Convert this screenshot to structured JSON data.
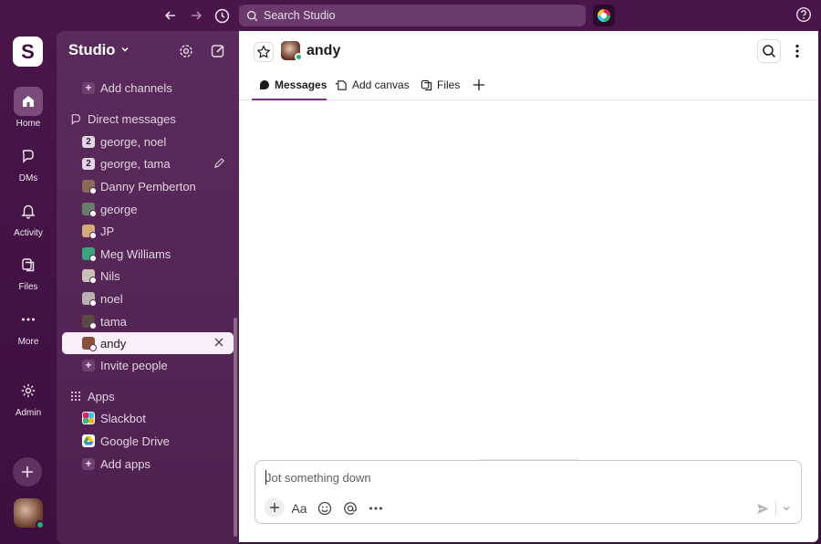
{
  "topbar": {
    "search_placeholder": "Search Studio"
  },
  "rail": {
    "logo_letter": "S",
    "items": [
      {
        "label": "Home",
        "icon": "home-icon"
      },
      {
        "label": "DMs",
        "icon": "dms-icon"
      },
      {
        "label": "Activity",
        "icon": "bell-icon"
      },
      {
        "label": "Files",
        "icon": "files-icon"
      },
      {
        "label": "More",
        "icon": "more-icon"
      },
      {
        "label": "Admin",
        "icon": "gear-icon"
      }
    ]
  },
  "sidebar": {
    "workspace": "Studio",
    "add_channels": "Add channels",
    "dm_section": "Direct messages",
    "dms": [
      {
        "label": "george, noel",
        "badge": "2"
      },
      {
        "label": "george, tama",
        "badge": "2"
      },
      {
        "label": "Danny Pemberton"
      },
      {
        "label": "george"
      },
      {
        "label": "JP"
      },
      {
        "label": "Meg Williams"
      },
      {
        "label": "Nils"
      },
      {
        "label": "noel"
      },
      {
        "label": "tama"
      },
      {
        "label": "andy",
        "active": true
      }
    ],
    "invite_people": "Invite people",
    "apps_section": "Apps",
    "apps": [
      {
        "label": "Slackbot"
      },
      {
        "label": "Google Drive"
      }
    ],
    "add_apps": "Add apps"
  },
  "channel": {
    "name": "andy",
    "tabs": [
      {
        "label": "Messages",
        "active": true
      },
      {
        "label": "Add canvas"
      },
      {
        "label": "Files"
      }
    ]
  },
  "composer": {
    "placeholder": "Jot something down",
    "format_label": "Aa"
  },
  "colors": {
    "sidebar_bg": "#5a2a5c",
    "accent": "#7c3085",
    "online": "#2bac76"
  }
}
